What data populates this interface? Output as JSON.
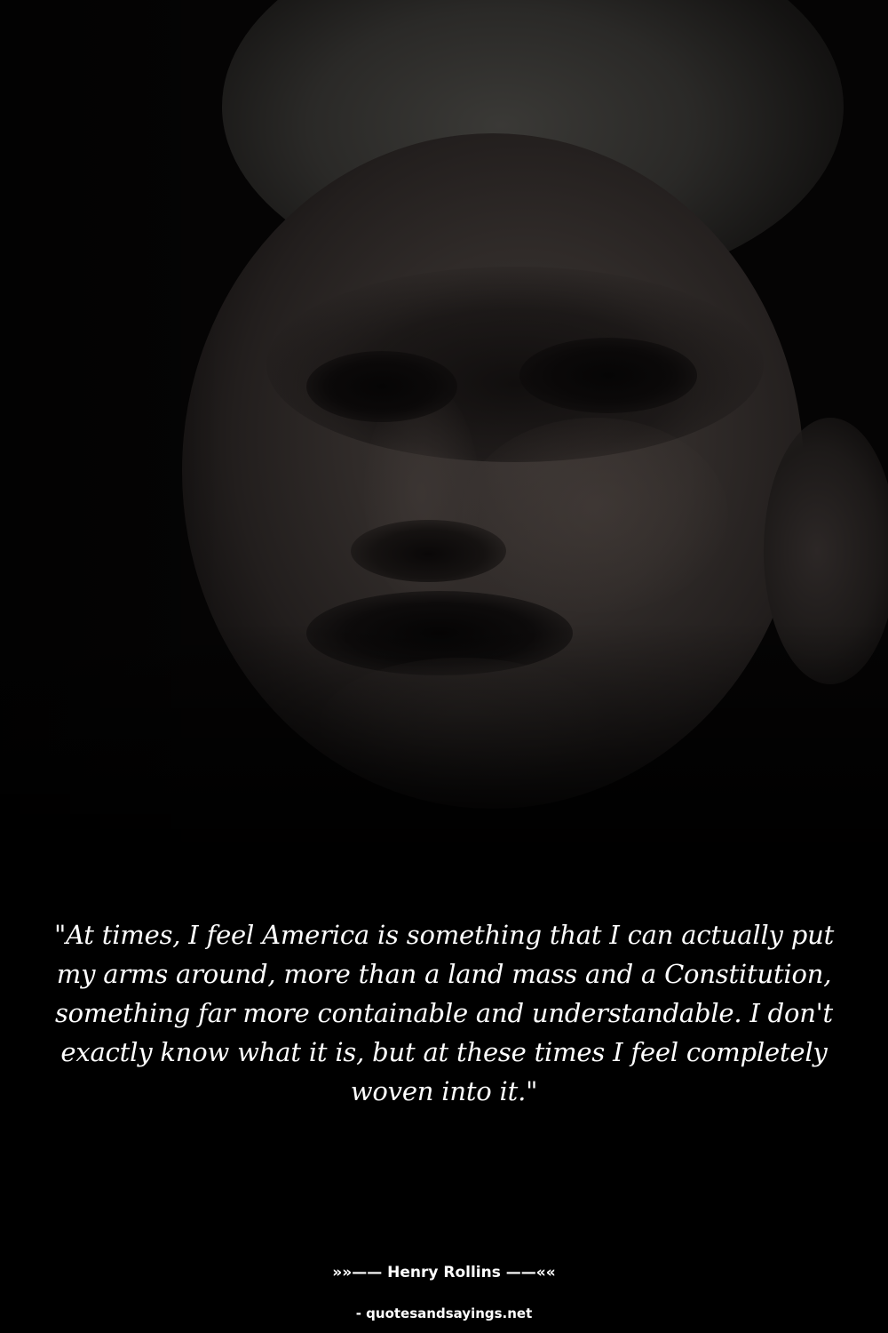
{
  "image": {
    "description_icon": "portrait-photo",
    "background_color": "#000000"
  },
  "quote": {
    "text": "\"At times, I feel America is something that I can actually put my arms around, more than a land mass and a Constitution, something far more containable and understandable. I don't exactly know what it is, but at these times I feel completely woven into it.\""
  },
  "author": {
    "text": "»»—— Henry Rollins ——««"
  },
  "source": {
    "text": "- quotesandsayings.net"
  }
}
